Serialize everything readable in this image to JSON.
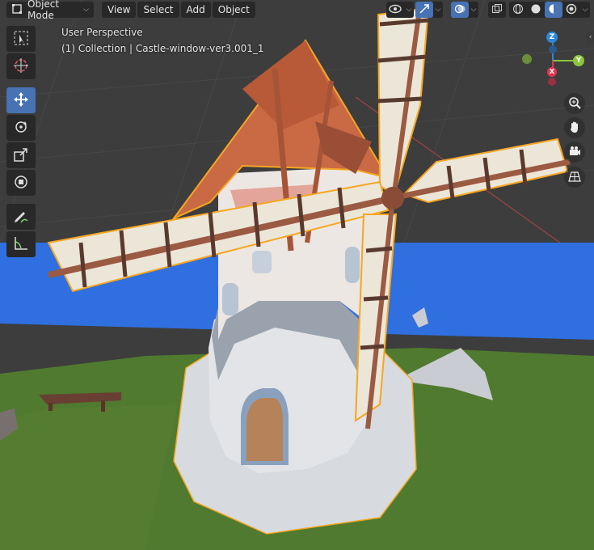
{
  "header": {
    "mode_label": "Object Mode",
    "menus": [
      {
        "label": "View"
      },
      {
        "label": "Select"
      },
      {
        "label": "Add"
      },
      {
        "label": "Object"
      }
    ]
  },
  "overlay": {
    "perspective_label": "User Perspective",
    "collection_label": "(1) Collection | Castle-window-ver3.001_1"
  },
  "gizmo": {
    "axes": {
      "x": "X",
      "y": "Y",
      "z": "Z"
    },
    "colors": {
      "x": "#e3364e",
      "y": "#8bc63d",
      "z": "#2d87d8"
    }
  },
  "tools": [
    {
      "name": "select-box"
    },
    {
      "name": "cursor"
    },
    {
      "name": "move"
    },
    {
      "name": "rotate"
    },
    {
      "name": "scale"
    },
    {
      "name": "transform"
    },
    {
      "name": "annotate"
    },
    {
      "name": "measure"
    }
  ],
  "colors": {
    "accent": "#4772b3",
    "selection_outline": "#f5a623",
    "ground": "#4f7a2f",
    "water": "#2f6fe0"
  }
}
